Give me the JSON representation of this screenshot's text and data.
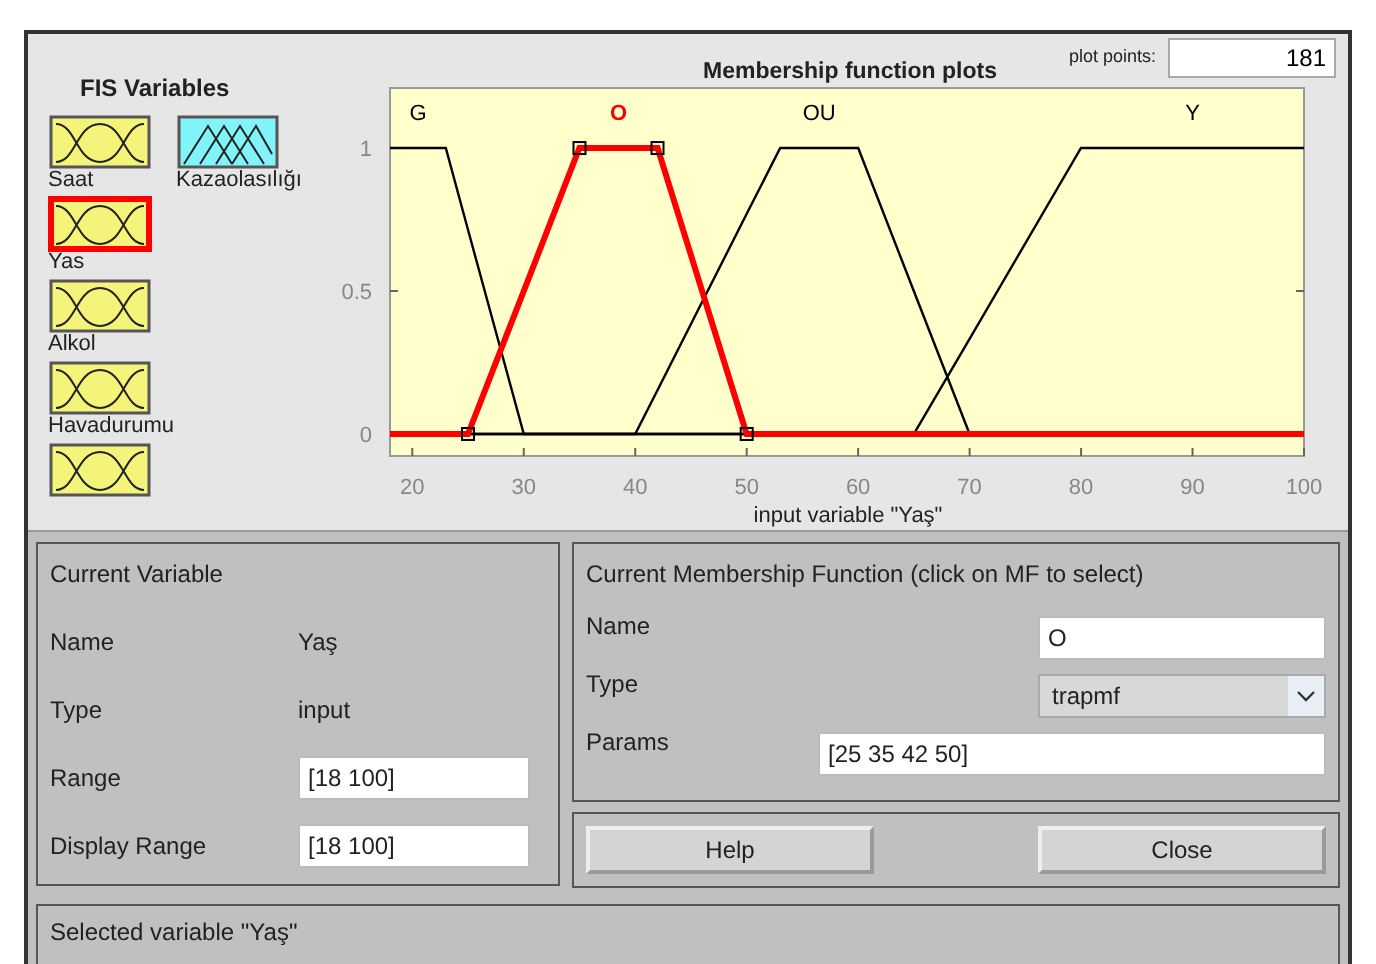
{
  "fis_variables": {
    "title": "FIS Variables",
    "items": [
      {
        "name": "Saat",
        "kind": "input",
        "selected": false
      },
      {
        "name": "Kazaolasılığı",
        "kind": "output",
        "selected": false
      },
      {
        "name": "Yas",
        "kind": "input",
        "selected": true
      },
      {
        "name": "Alkol",
        "kind": "input",
        "selected": false
      },
      {
        "name": "Havadurumu",
        "kind": "input",
        "selected": false
      },
      {
        "kind": "input",
        "selected": false
      }
    ]
  },
  "plot": {
    "plot_points_label": "plot points:",
    "plot_points": "181",
    "chart_data": {
      "type": "line",
      "title": "Membership function plots",
      "xlabel": "input variable \"Yaş\"",
      "x": [
        18,
        23,
        25,
        30,
        35,
        40,
        42,
        50,
        53,
        60,
        65,
        70,
        80,
        100
      ],
      "series": [
        {
          "name": "G",
          "color": "#000000",
          "values": [
            1,
            1,
            0.714,
            0,
            0,
            0,
            0,
            0,
            0,
            0,
            0,
            0,
            0,
            0
          ]
        },
        {
          "name": "OU",
          "color": "#000000",
          "values": [
            0,
            0,
            0,
            0,
            0,
            0,
            0.154,
            0.769,
            1,
            1,
            0.5,
            0,
            0,
            0
          ]
        },
        {
          "name": "Y",
          "color": "#000000",
          "values": [
            0,
            0,
            0,
            0,
            0,
            0,
            0,
            0,
            0,
            0,
            0,
            0.333,
            1,
            1
          ]
        },
        {
          "name": "O",
          "color": "#ff0000",
          "values": [
            0,
            0,
            0,
            0.5,
            1,
            1,
            1,
            0,
            0,
            0,
            0,
            0,
            0,
            0
          ]
        }
      ],
      "xlim": [
        18,
        100
      ],
      "ylim": [
        -0.077,
        1.21
      ],
      "xticks": [
        20,
        30,
        40,
        50,
        60,
        70,
        80,
        90,
        100
      ],
      "yticks": [
        0,
        0.5,
        1
      ]
    },
    "function_states": [
      {
        "selected": false
      },
      {
        "selected": false
      },
      {
        "selected": false
      },
      {
        "selected": true
      }
    ]
  },
  "current_variable": {
    "title": "Current Variable",
    "fields": [
      {
        "label": "Name",
        "value": "Yaş",
        "kind": "text"
      },
      {
        "label": "Type",
        "value": "input",
        "kind": "text"
      },
      {
        "label": "Range",
        "value": "[18 100]",
        "kind": "input"
      },
      {
        "label": "Display Range",
        "value": "[18 100]",
        "kind": "input"
      }
    ]
  },
  "current_mf": {
    "title": "Current Membership Function (click on MF to select)",
    "name_label": "Name",
    "name": "O",
    "type_label": "Type",
    "type": "trapmf",
    "params_label": "Params",
    "params": "[25 35 42 50]"
  },
  "buttons": [
    "Help",
    "Close"
  ],
  "status": "Selected variable \"Yaş\""
}
